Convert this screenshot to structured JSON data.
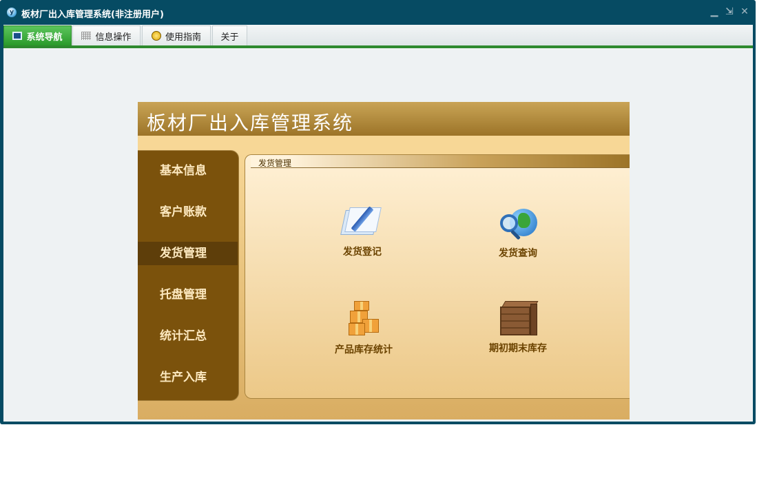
{
  "window": {
    "title": "板材厂出入库管理系统(非注册用户)",
    "app_icon": "y"
  },
  "window_controls": {
    "minimize": "▁",
    "restore": "⇲",
    "close": "✕"
  },
  "tabs": [
    {
      "label": "系统导航",
      "icon": "monitor-icon",
      "active": true
    },
    {
      "label": "信息操作",
      "icon": "grid-icon",
      "active": false
    },
    {
      "label": "使用指南",
      "icon": "guide-icon",
      "active": false
    },
    {
      "label": "关于",
      "icon": "",
      "active": false
    }
  ],
  "panel": {
    "title": "板材厂出入库管理系统",
    "menu": [
      {
        "label": "基本信息",
        "selected": false
      },
      {
        "label": "客户账款",
        "selected": false
      },
      {
        "label": "发货管理",
        "selected": true
      },
      {
        "label": "托盘管理",
        "selected": false
      },
      {
        "label": "统计汇总",
        "selected": false
      },
      {
        "label": "生产入库",
        "selected": false
      }
    ],
    "content_title": "发货管理",
    "functions": [
      {
        "label": "发货登记",
        "icon": "register-icon"
      },
      {
        "label": "发货查询",
        "icon": "query-icon"
      },
      {
        "label": "产品库存统计",
        "icon": "stock-icon"
      },
      {
        "label": "期初期末库存",
        "icon": "crate-icon"
      }
    ]
  },
  "colors": {
    "titlebar": "#064b63",
    "tab_active": "#2a9a2a",
    "menu": "#7b520c",
    "header": "#9c7428"
  }
}
